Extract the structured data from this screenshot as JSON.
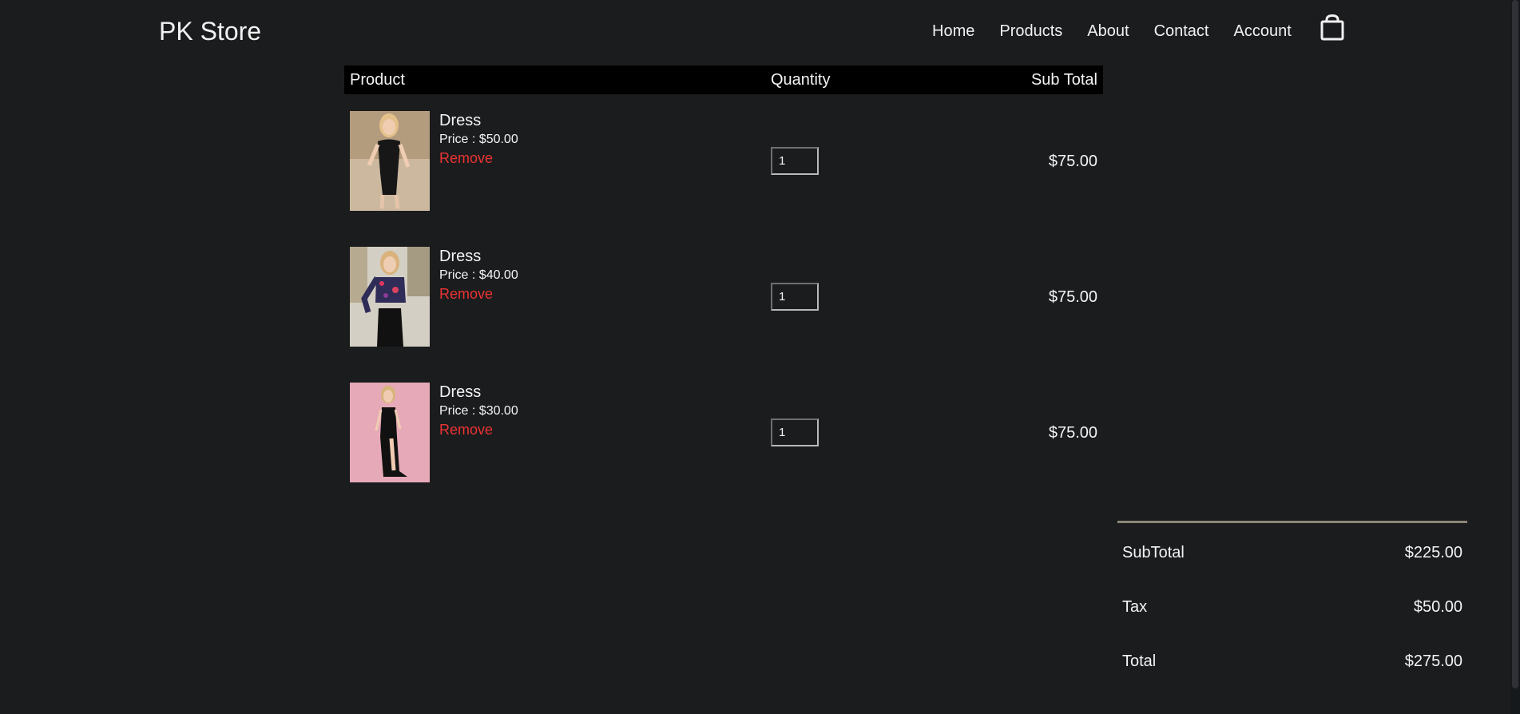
{
  "header": {
    "logo": "PK Store",
    "nav": [
      "Home",
      "Products",
      "About",
      "Contact",
      "Account"
    ]
  },
  "cart": {
    "columns": [
      "Product",
      "Quantity",
      "Sub Total"
    ],
    "items": [
      {
        "name": "Dress",
        "price": "Price : $50.00",
        "remove": "Remove",
        "quantity": "1",
        "subtotal": "$75.00"
      },
      {
        "name": "Dress",
        "price": "Price : $40.00",
        "remove": "Remove",
        "quantity": "1",
        "subtotal": "$75.00"
      },
      {
        "name": "Dress",
        "price": "Price : $30.00",
        "remove": "Remove",
        "quantity": "1",
        "subtotal": "$75.00"
      }
    ]
  },
  "summary": {
    "subtotal_label": "SubTotal",
    "subtotal_value": "$225.00",
    "tax_label": "Tax",
    "tax_value": "$50.00",
    "total_label": "Total",
    "total_value": "$275.00"
  },
  "colors": {
    "background": "#1b1c1e",
    "remove_link": "#ea3433",
    "table_header": "#000000",
    "summary_rule": "#8b8674"
  },
  "icons": {
    "cart": "shopping-bag-icon"
  }
}
